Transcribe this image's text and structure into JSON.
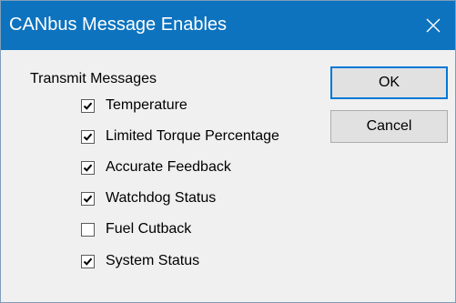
{
  "window": {
    "title": "CANbus Message Enables",
    "close_glyph": "close-icon"
  },
  "group": {
    "label": "Transmit Messages",
    "items": [
      {
        "label": "Temperature",
        "checked": true
      },
      {
        "label": "Limited Torque Percentage",
        "checked": true
      },
      {
        "label": "Accurate Feedback",
        "checked": true
      },
      {
        "label": "Watchdog Status",
        "checked": true
      },
      {
        "label": "Fuel Cutback",
        "checked": false
      },
      {
        "label": "System Status",
        "checked": true
      }
    ]
  },
  "buttons": {
    "ok_label": "OK",
    "cancel_label": "Cancel"
  },
  "colors": {
    "titlebar": "#0d73bf",
    "default_button_border": "#0078d7"
  }
}
